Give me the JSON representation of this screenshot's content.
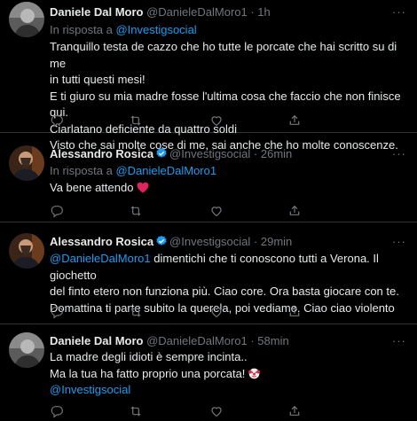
{
  "tweets": [
    {
      "name": "Daniele Dal Moro",
      "handle": "@DanieleDalMoro1",
      "time": "1h",
      "reply_prefix": "In risposta a",
      "reply_to": "@Investigsocial",
      "lines": [
        "Tranquillo testa de cazzo che ho tutte le porcate che hai scritto su di me",
        "in tutti questi mesi!",
        "E ti giuro su mia madre fosse l'ultima cosa che faccio che non finisce qui.",
        "Ciarlatano deficiente da quattro soldi",
        "Visto che sai molte cose di me, sai anche che ho molte conoscenze."
      ]
    },
    {
      "name": "Alessandro Rosica",
      "handle": "@Investigsocial",
      "time": "26min",
      "reply_prefix": "In risposta a",
      "reply_to": "@DanieleDalMoro1",
      "text": "Va bene attendo"
    },
    {
      "name": "Alessandro Rosica",
      "handle": "@Investigsocial",
      "time": "29min",
      "mention": "@DanieleDalMoro1",
      "line1_rest": " dimentichi che ti conoscono tutti a Verona. Il giochetto",
      "line2": "del finto etero non funziona più. Ciao core. Ora basta giocare con te.",
      "line3": "Domattina ti parte subito la querela, poi vediamo. Ciao ciao violento"
    },
    {
      "name": "Daniele Dal Moro",
      "handle": "@DanieleDalMoro1",
      "time": "58min",
      "line1": "La madre degli idioti è sempre incinta..",
      "line2": "Ma la tua ha fatto proprio una porcata!",
      "mention": "@Investigsocial"
    }
  ],
  "separator": " · ",
  "more_label": "···",
  "colors": {
    "background": "#000000",
    "text": "#e7e9ea",
    "muted": "#71767b",
    "link": "#1d9bf0",
    "heart": "#f91880"
  },
  "icons": [
    "reply-icon",
    "retweet-icon",
    "like-icon",
    "share-icon",
    "verified-badge-icon",
    "red-heart-emoji",
    "clown-emoji"
  ]
}
